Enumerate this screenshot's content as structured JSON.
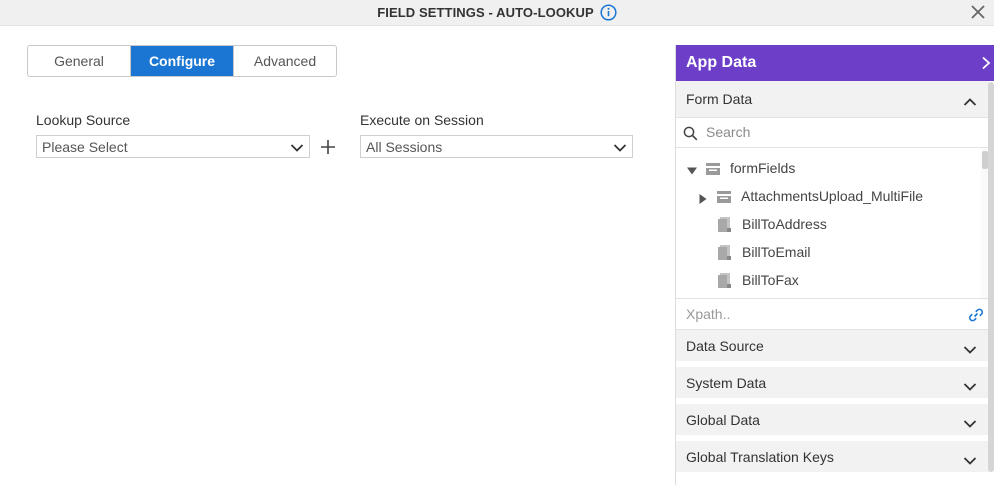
{
  "dialog": {
    "title": "FIELD SETTINGS - AUTO-LOOKUP"
  },
  "tabs": [
    {
      "label": "General"
    },
    {
      "label": "Configure"
    },
    {
      "label": "Advanced"
    }
  ],
  "form": {
    "lookup_source_label": "Lookup Source",
    "lookup_source_value": "Please Select",
    "execute_session_label": "Execute on Session",
    "execute_session_value": "All Sessions"
  },
  "app_data": {
    "title": "App Data",
    "form_data_label": "Form Data",
    "search_placeholder": "Search",
    "tree": [
      {
        "label": "formFields",
        "kind": "object",
        "expanded": true
      },
      {
        "label": "AttachmentsUpload_MultiFile",
        "kind": "object",
        "expanded": false
      },
      {
        "label": "BillToAddress",
        "kind": "field"
      },
      {
        "label": "BillToEmail",
        "kind": "field"
      },
      {
        "label": "BillToFax",
        "kind": "field"
      }
    ],
    "xpath_placeholder": "Xpath..",
    "sections": [
      {
        "label": "Data Source"
      },
      {
        "label": "System Data"
      },
      {
        "label": "Global Data"
      },
      {
        "label": "Global Translation Keys"
      }
    ]
  },
  "colors": {
    "accent_blue": "#1a76d2",
    "panel_purple": "#6d3fc9"
  }
}
